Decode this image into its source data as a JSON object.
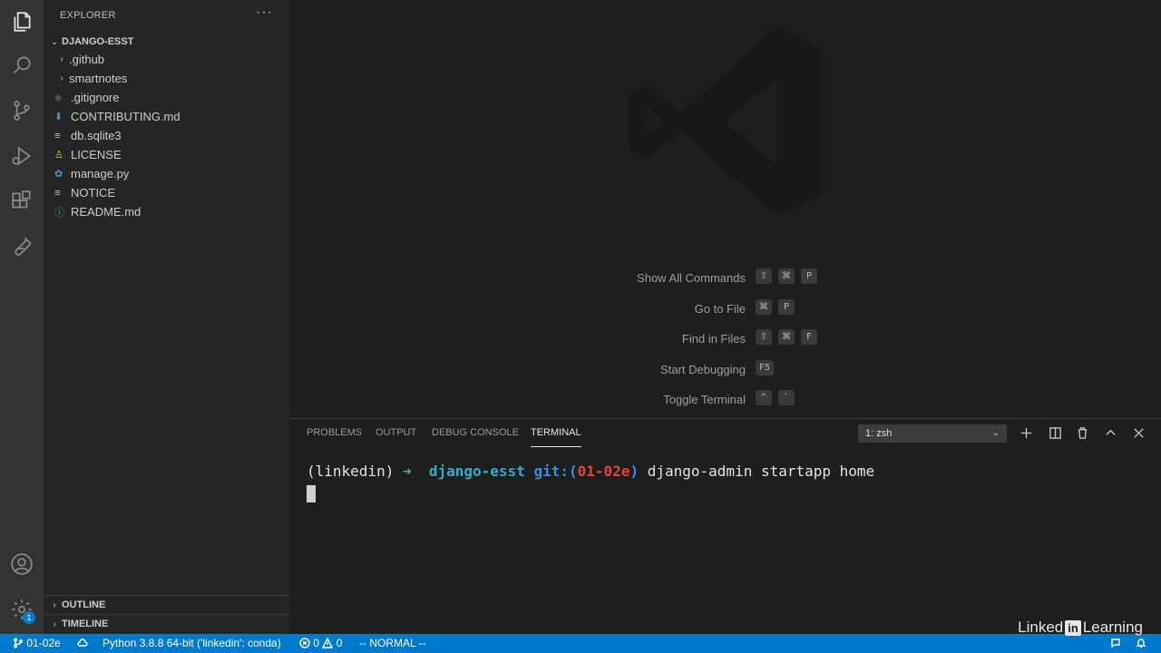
{
  "sidebar": {
    "title": "EXPLORER",
    "more": "···",
    "folder": "DJANGO-ESST",
    "items": [
      {
        "name": ".github",
        "type": "folder"
      },
      {
        "name": "smartnotes",
        "type": "folder"
      },
      {
        "name": ".gitignore",
        "type": "file",
        "icon": "gitignore-icon",
        "color": "#41535b"
      },
      {
        "name": "CONTRIBUTING.md",
        "type": "file",
        "icon": "markdown-download-icon",
        "color": "#519aba"
      },
      {
        "name": "db.sqlite3",
        "type": "file",
        "icon": "lines-icon",
        "color": "#c5c5c5"
      },
      {
        "name": "LICENSE",
        "type": "file",
        "icon": "license-icon",
        "color": "#cbcb41"
      },
      {
        "name": "manage.py",
        "type": "file",
        "icon": "python-icon",
        "color": "#519aba"
      },
      {
        "name": "NOTICE",
        "type": "file",
        "icon": "lines-icon",
        "color": "#c5c5c5"
      },
      {
        "name": "README.md",
        "type": "file",
        "icon": "info-icon",
        "color": "#519aba"
      }
    ],
    "sections": [
      "OUTLINE",
      "TIMELINE"
    ]
  },
  "activity_bar": {
    "items": [
      "explorer-icon",
      "search-icon",
      "source-control-icon",
      "run-debug-icon",
      "extensions-icon",
      "testing-icon"
    ],
    "bottom": [
      "account-icon",
      "settings-gear-icon"
    ],
    "badge": "1"
  },
  "editor": {
    "hints": [
      {
        "label": "Show All Commands",
        "keys": [
          "⇧",
          "⌘",
          "P"
        ]
      },
      {
        "label": "Go to File",
        "keys": [
          "⌘",
          "P"
        ]
      },
      {
        "label": "Find in Files",
        "keys": [
          "⇧",
          "⌘",
          "F"
        ]
      },
      {
        "label": "Start Debugging",
        "keys": [
          "F5"
        ]
      },
      {
        "label": "Toggle Terminal",
        "keys": [
          "^",
          "`"
        ]
      }
    ]
  },
  "panel": {
    "tabs": [
      "PROBLEMS",
      "OUTPUT",
      "DEBUG CONSOLE",
      "TERMINAL"
    ],
    "active_tab": "TERMINAL",
    "terminal_select": "1: zsh",
    "terminal": {
      "env": "(linkedin)",
      "arrow": "➜",
      "dir": "django-esst",
      "git_label": "git:(",
      "branch": "01-02e",
      "git_close": ")",
      "command": "django-admin startapp home"
    }
  },
  "statusbar": {
    "branch": "01-02e",
    "python": "Python 3.8.8 64-bit ('linkedin': conda)",
    "errors": "0",
    "warnings": "0",
    "mode": "-- NORMAL --"
  },
  "watermark": {
    "brand_left": "Linked",
    "brand_in": "in",
    "brand_right": "Learning"
  },
  "colors": {
    "accent": "#007acc",
    "activity_bar": "#333333",
    "sidebar": "#252526",
    "editor": "#1e1e1e"
  }
}
